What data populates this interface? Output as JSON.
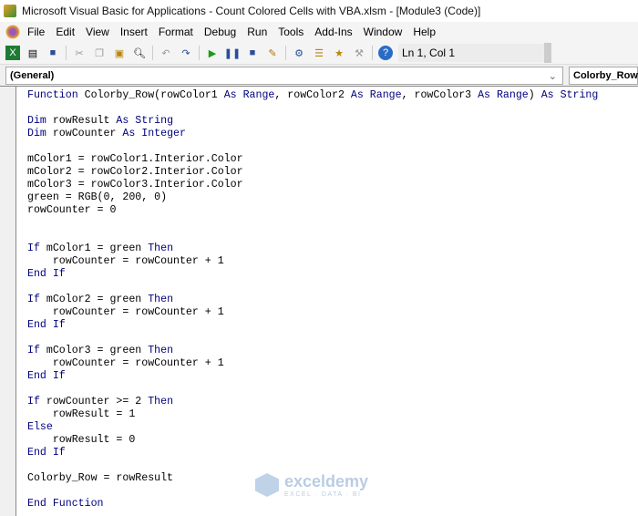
{
  "window": {
    "title": "Microsoft Visual Basic for Applications - Count Colored Cells with VBA.xlsm - [Module3 (Code)]"
  },
  "menu": [
    "File",
    "Edit",
    "View",
    "Insert",
    "Format",
    "Debug",
    "Run",
    "Tools",
    "Add-Ins",
    "Window",
    "Help"
  ],
  "toolbar": {
    "status": "Ln 1, Col 1"
  },
  "combos": {
    "object": "(General)",
    "procedure": "Colorby_Row"
  },
  "watermark": {
    "name": "exceldemy",
    "tagline": "EXCEL · DATA · BI"
  },
  "code": [
    [
      [
        "Function",
        "k"
      ],
      [
        " Colorby_Row(rowColor1 ",
        ""
      ],
      [
        "As",
        "k"
      ],
      [
        " ",
        ""
      ],
      [
        "Range",
        "k"
      ],
      [
        ", rowColor2 ",
        ""
      ],
      [
        "As",
        "k"
      ],
      [
        " ",
        ""
      ],
      [
        "Range",
        "k"
      ],
      [
        ", rowColor3 ",
        ""
      ],
      [
        "As",
        "k"
      ],
      [
        " ",
        ""
      ],
      [
        "Range",
        "k"
      ],
      [
        ") ",
        ""
      ],
      [
        "As",
        "k"
      ],
      [
        " ",
        ""
      ],
      [
        "String",
        "k"
      ]
    ],
    [],
    [
      [
        "Dim",
        "k"
      ],
      [
        " rowResult ",
        ""
      ],
      [
        "As",
        "k"
      ],
      [
        " ",
        ""
      ],
      [
        "String",
        "k"
      ]
    ],
    [
      [
        "Dim",
        "k"
      ],
      [
        " rowCounter ",
        ""
      ],
      [
        "As",
        "k"
      ],
      [
        " ",
        ""
      ],
      [
        "Integer",
        "k"
      ]
    ],
    [],
    [
      [
        "mColor1 = rowColor1.Interior.Color",
        ""
      ]
    ],
    [
      [
        "mColor2 = rowColor2.Interior.Color",
        ""
      ]
    ],
    [
      [
        "mColor3 = rowColor3.Interior.Color",
        ""
      ]
    ],
    [
      [
        "green = RGB(0, 200, 0)",
        ""
      ]
    ],
    [
      [
        "rowCounter = 0",
        ""
      ]
    ],
    [],
    [],
    [
      [
        "If",
        "k"
      ],
      [
        " mColor1 = green ",
        ""
      ],
      [
        "Then",
        "k"
      ]
    ],
    [
      [
        "    rowCounter = rowCounter + 1",
        ""
      ]
    ],
    [
      [
        "End If",
        "k"
      ]
    ],
    [],
    [
      [
        "If",
        "k"
      ],
      [
        " mColor2 = green ",
        ""
      ],
      [
        "Then",
        "k"
      ]
    ],
    [
      [
        "    rowCounter = rowCounter + 1",
        ""
      ]
    ],
    [
      [
        "End If",
        "k"
      ]
    ],
    [],
    [
      [
        "If",
        "k"
      ],
      [
        " mColor3 = green ",
        ""
      ],
      [
        "Then",
        "k"
      ]
    ],
    [
      [
        "    rowCounter = rowCounter + 1",
        ""
      ]
    ],
    [
      [
        "End If",
        "k"
      ]
    ],
    [],
    [
      [
        "If",
        "k"
      ],
      [
        " rowCounter >= 2 ",
        ""
      ],
      [
        "Then",
        "k"
      ]
    ],
    [
      [
        "    rowResult = 1",
        ""
      ]
    ],
    [
      [
        "Else",
        "k"
      ]
    ],
    [
      [
        "    rowResult = 0",
        ""
      ]
    ],
    [
      [
        "End If",
        "k"
      ]
    ],
    [],
    [
      [
        "Colorby_Row = rowResult",
        ""
      ]
    ],
    [],
    [
      [
        "End Function",
        "k"
      ]
    ]
  ]
}
